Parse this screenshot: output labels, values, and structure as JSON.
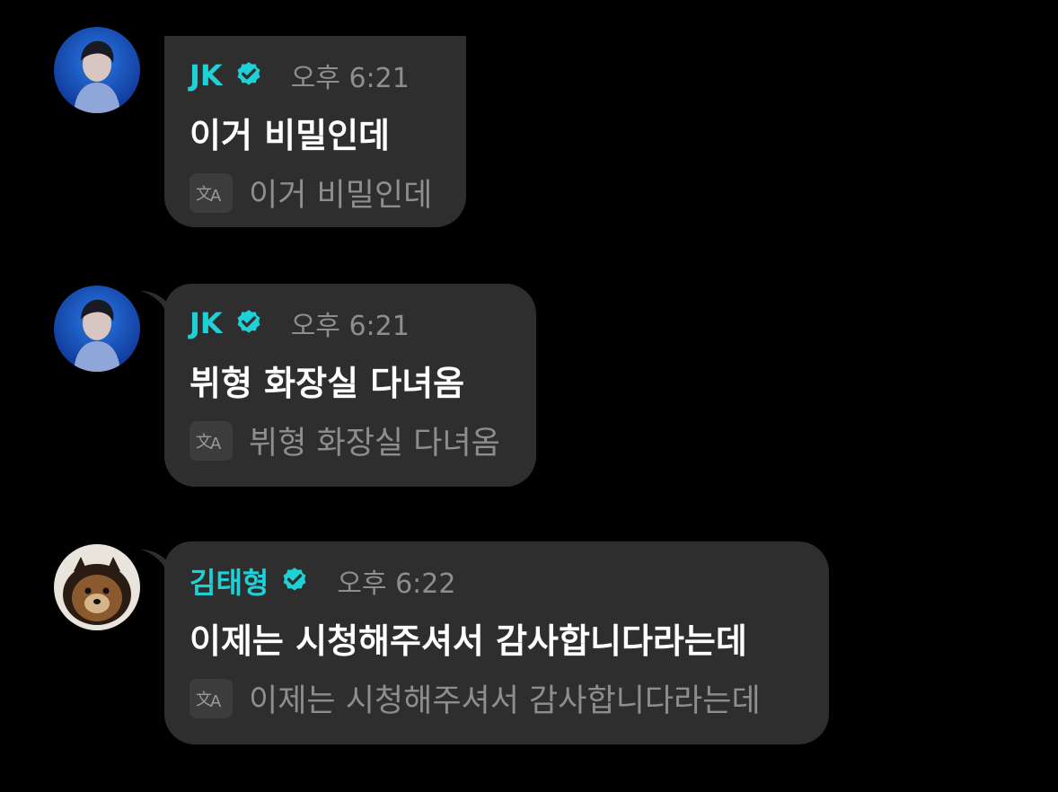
{
  "messages": [
    {
      "author": "JK",
      "verified": true,
      "time": "오후 6:21",
      "text": "이거 비밀인데",
      "translation": "이거 비밀인데",
      "avatar": "person-blue-portrait"
    },
    {
      "author": "JK",
      "verified": true,
      "time": "오후 6:21",
      "text": "뷔형 화장실 다녀옴",
      "translation": "뷔형 화장실 다녀옴",
      "avatar": "person-blue-portrait"
    },
    {
      "author": "김태형",
      "verified": true,
      "time": "오후 6:22",
      "text": "이제는 시청해주셔서 감사합니다라는데",
      "translation": "이제는 시청해주셔서 감사합니다라는데",
      "avatar": "pomeranian-dog"
    }
  ],
  "colors": {
    "background": "#000000",
    "bubble": "#2e2e2e",
    "name": "#1ed1d6",
    "verified": "#1ed1d6",
    "time": "#8e8e8e",
    "text": "#ffffff",
    "translation": "#8e8e8e"
  },
  "icons": {
    "verified": "verified-badge-icon",
    "translate": "translate-icon"
  }
}
